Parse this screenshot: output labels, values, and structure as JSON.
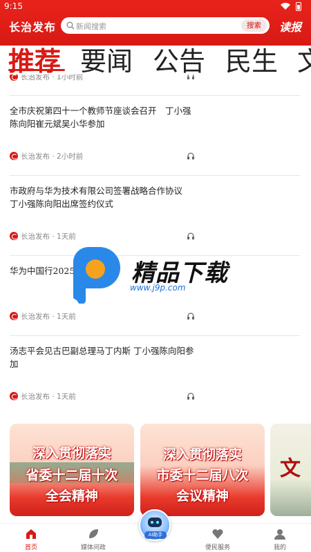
{
  "status": {
    "time": "9:15"
  },
  "header": {
    "brand": "长治发布",
    "search_placeholder": "新闻搜索",
    "search_button": "搜索",
    "read_button": "读报"
  },
  "tabs": [
    "推荐",
    "要闻",
    "公告",
    "民生",
    "文"
  ],
  "news": [
    {
      "title": "",
      "source": "长治发布",
      "time": "1小时前"
    },
    {
      "title": "全市庆祝第四十一个教师节座谈会召开　丁小强陈向阳崔元斌吴小华参加",
      "source": "长治发布",
      "time": "2小时前"
    },
    {
      "title": "市政府与华为技术有限公司签署战略合作协议　丁小强陈向阳出席签约仪式",
      "source": "长治发布",
      "time": "1天前"
    },
    {
      "title": "华为中国行2025",
      "source": "长治发布",
      "time": "1天前"
    },
    {
      "title": "汤志平会见古巴副总理马丁内斯 丁小强陈向阳参加",
      "source": "长治发布",
      "time": "1天前"
    }
  ],
  "watermark": {
    "text": "精品下载",
    "url": "www.j9p.com"
  },
  "banners": [
    {
      "lines": [
        "深入贯彻落实",
        "省委十二届十次",
        "全会精神"
      ]
    },
    {
      "lines": [
        "深入贯彻落实",
        "市委十二届八次",
        "会议精神"
      ]
    },
    {
      "lines": [
        "文"
      ]
    }
  ],
  "bottom_nav": [
    {
      "label": "首页",
      "icon": "home-icon",
      "active": true
    },
    {
      "label": "媒体问政",
      "icon": "leaf-icon",
      "active": false
    },
    {
      "label": "AI助手",
      "icon": "ai-robot-icon",
      "active": false
    },
    {
      "label": "便民服务",
      "icon": "heart-hand-icon",
      "active": false
    },
    {
      "label": "我的",
      "icon": "user-icon",
      "active": false
    }
  ],
  "colors": {
    "brand_red": "#d81a14",
    "text": "#222222",
    "meta": "#888888"
  }
}
